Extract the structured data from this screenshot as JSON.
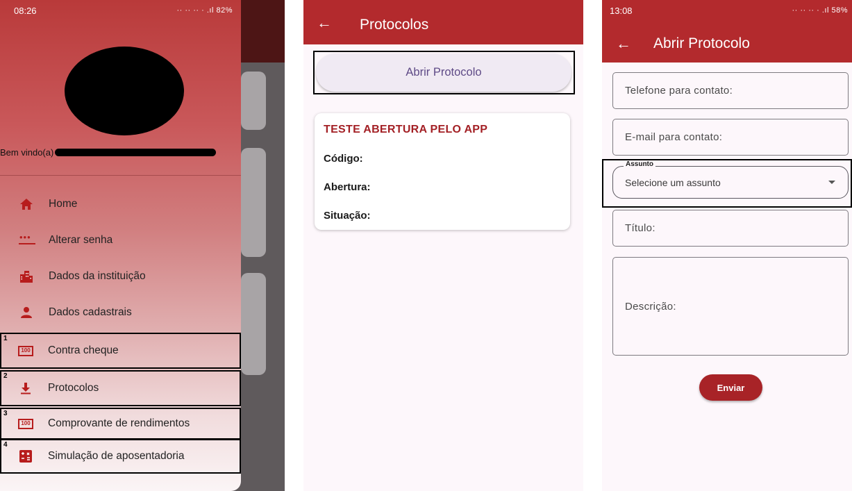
{
  "colors": {
    "primary": "#b32a2d",
    "accent_icon": "#b71c1c",
    "surface": "#fdf7fb",
    "button_text": "#5e4a86"
  },
  "drawer_screen": {
    "status_time": "08:26",
    "status_right": "·· ·· ·· · .ıl 82%",
    "welcome": "Bem vindo(a)",
    "menu": [
      {
        "label": "Home",
        "icon": "home-icon",
        "marker": ""
      },
      {
        "label": "Alterar senha",
        "icon": "password-icon",
        "marker": ""
      },
      {
        "label": "Dados da instituição",
        "icon": "building-icon",
        "marker": ""
      },
      {
        "label": "Dados cadastrais",
        "icon": "person-icon",
        "marker": ""
      },
      {
        "label": "Contra cheque",
        "icon": "receipt-100-icon",
        "marker": "1"
      },
      {
        "label": "Protocolos",
        "icon": "download-icon",
        "marker": "2"
      },
      {
        "label": "Comprovante de rendimentos",
        "icon": "receipt-100-icon",
        "marker": "3"
      },
      {
        "label": "Simulação de aposentadoria",
        "icon": "calculator-icon",
        "marker": "4"
      }
    ],
    "icon_100_text": "100",
    "calc_text": "−×\n+="
  },
  "protocolos_screen": {
    "back": "←",
    "title": "Protocolos",
    "open_button": "Abrir Protocolo",
    "card": {
      "title": "TESTE ABERTURA PELO APP",
      "code_label": "Código:",
      "opening_label": "Abertura:",
      "status_label": "Situação:"
    }
  },
  "abrir_screen": {
    "status_time": "13:08",
    "status_right": "·· ·· ·· · .ıl 58%",
    "back": "←",
    "title": "Abrir Protocolo",
    "phone_placeholder": "Telefone para contato:",
    "email_placeholder": "E-mail para contato:",
    "subject_legend": "Assunto",
    "subject_value": "Selecione um assunto",
    "title_placeholder": "Título:",
    "description_placeholder": "Descrição:",
    "send_button": "Enviar"
  }
}
